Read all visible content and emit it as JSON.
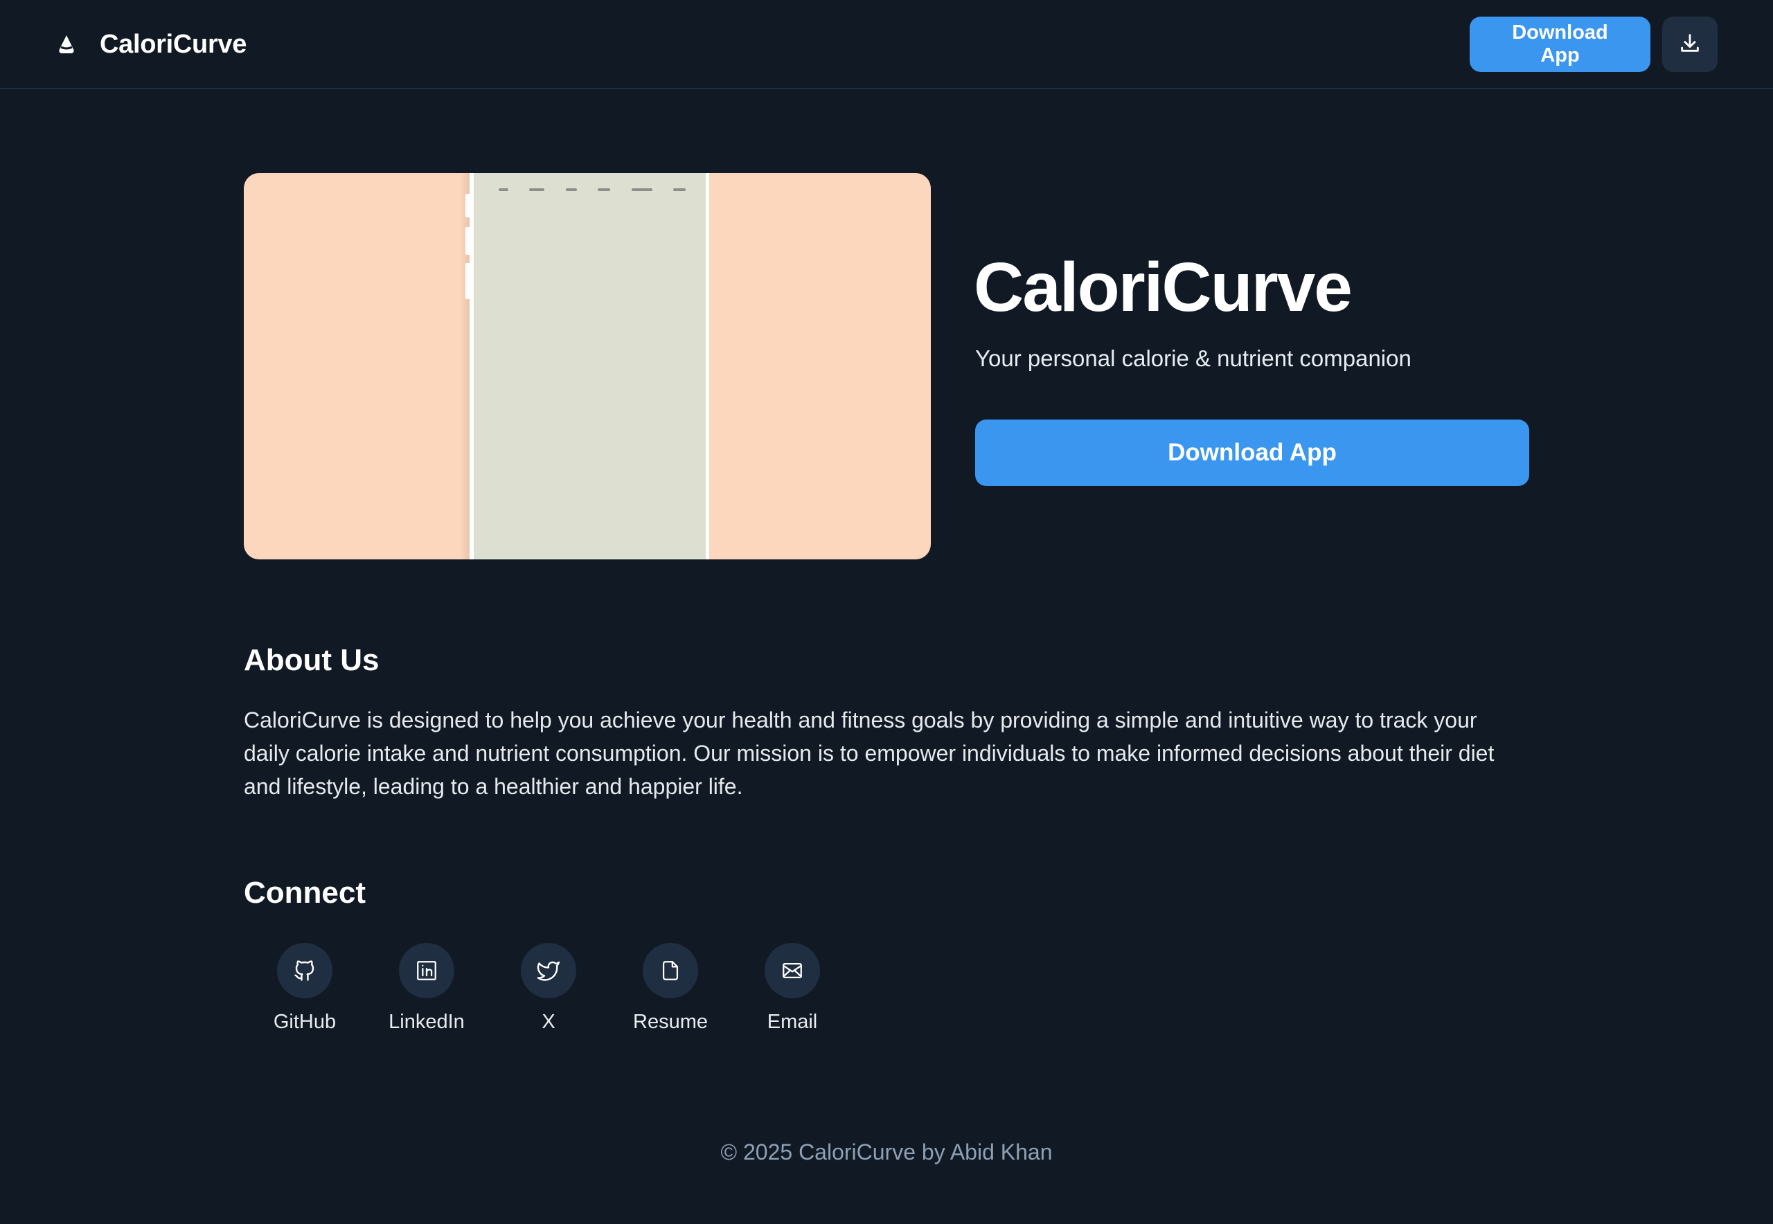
{
  "header": {
    "brand_name": "CaloriCurve",
    "brand_icon": "droplet-icon",
    "download_label": "Download App",
    "download_icon": "download-icon"
  },
  "hero": {
    "title": "CaloriCurve",
    "subtitle": "Your personal calorie & nutrient companion",
    "download_label": "Download App"
  },
  "about": {
    "heading": "About Us",
    "text": "CaloriCurve is designed to help you achieve your health and fitness goals by providing a simple and intuitive way to track your daily calorie intake and nutrient consumption. Our mission is to empower individuals to make informed decisions about their diet and lifestyle, leading to a healthier and happier life."
  },
  "connect": {
    "heading": "Connect",
    "links": [
      {
        "label": "GitHub",
        "icon": "github-icon"
      },
      {
        "label": "LinkedIn",
        "icon": "linkedin-icon"
      },
      {
        "label": "X",
        "icon": "twitter-icon"
      },
      {
        "label": "Resume",
        "icon": "document-icon"
      },
      {
        "label": "Email",
        "icon": "mail-icon"
      }
    ]
  },
  "footer": {
    "text": "© 2025 CaloriCurve by Abid Khan"
  },
  "colors": {
    "background": "#111a24",
    "accent": "#3b96f0",
    "surface": "#1f2e41",
    "hero_image_bg": "#fcd6bd",
    "phone_screen": "#dde0d1",
    "footer_text": "#8ea0b6"
  }
}
